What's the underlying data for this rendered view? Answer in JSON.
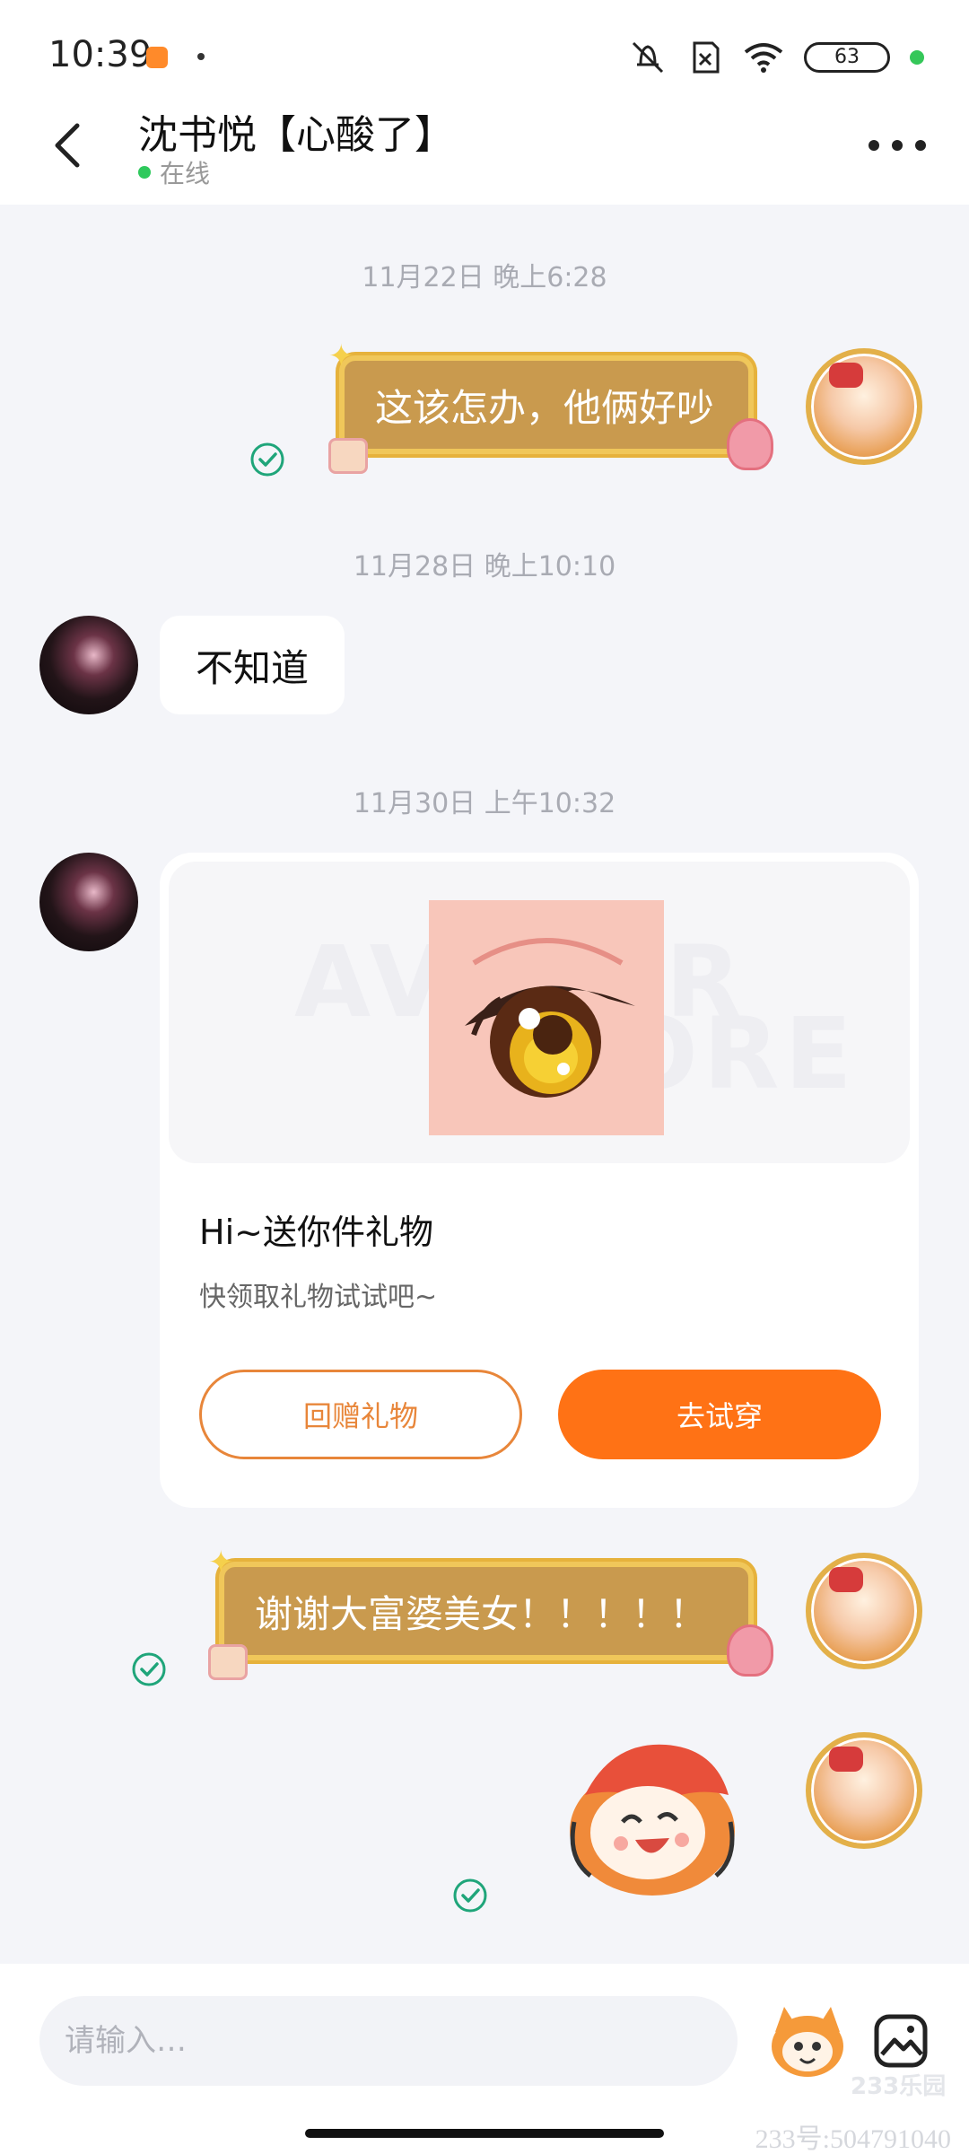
{
  "status_bar": {
    "time": "10:39",
    "battery": "63",
    "icons": [
      "app-notification-icon",
      "mute-icon",
      "no-sim-icon",
      "wifi-icon",
      "battery-icon"
    ]
  },
  "header": {
    "contact_name": "沈书悦【心酸了】",
    "status": "在线",
    "back_icon": "back-arrow-icon",
    "more_icon": "more-icon"
  },
  "messages": [
    {
      "timestamp": "11月22日 晚上6:28",
      "sender": "self",
      "text": "这该怎办，他俩好吵"
    },
    {
      "timestamp": "11月28日 晚上10:10",
      "sender": "other",
      "text": "不知道"
    },
    {
      "timestamp": "11月30日 上午10:32",
      "sender": "other",
      "type": "gift",
      "gift": {
        "watermark_1": "AVATAR",
        "watermark_2": "STORE",
        "title": "Hi~送你件礼物",
        "subtitle": "快领取礼物试试吧~",
        "return_button": "回赠礼物",
        "try_button": "去试穿"
      }
    },
    {
      "sender": "self",
      "text": "谢谢大富婆美女！！！！！"
    },
    {
      "sender": "self",
      "type": "sticker",
      "sticker": "sticker-laughing-icon"
    }
  ],
  "input": {
    "placeholder": "请输入…",
    "emoji_icon": "emoji-icon",
    "image_icon": "image-icon"
  },
  "watermark": {
    "brand": "233乐园",
    "user_id": "233号:504791040"
  },
  "colors": {
    "accent": "#ff7215",
    "online": "#2ec95c",
    "check": "#1fa57a",
    "bubble_gold": "#c99a4e"
  }
}
